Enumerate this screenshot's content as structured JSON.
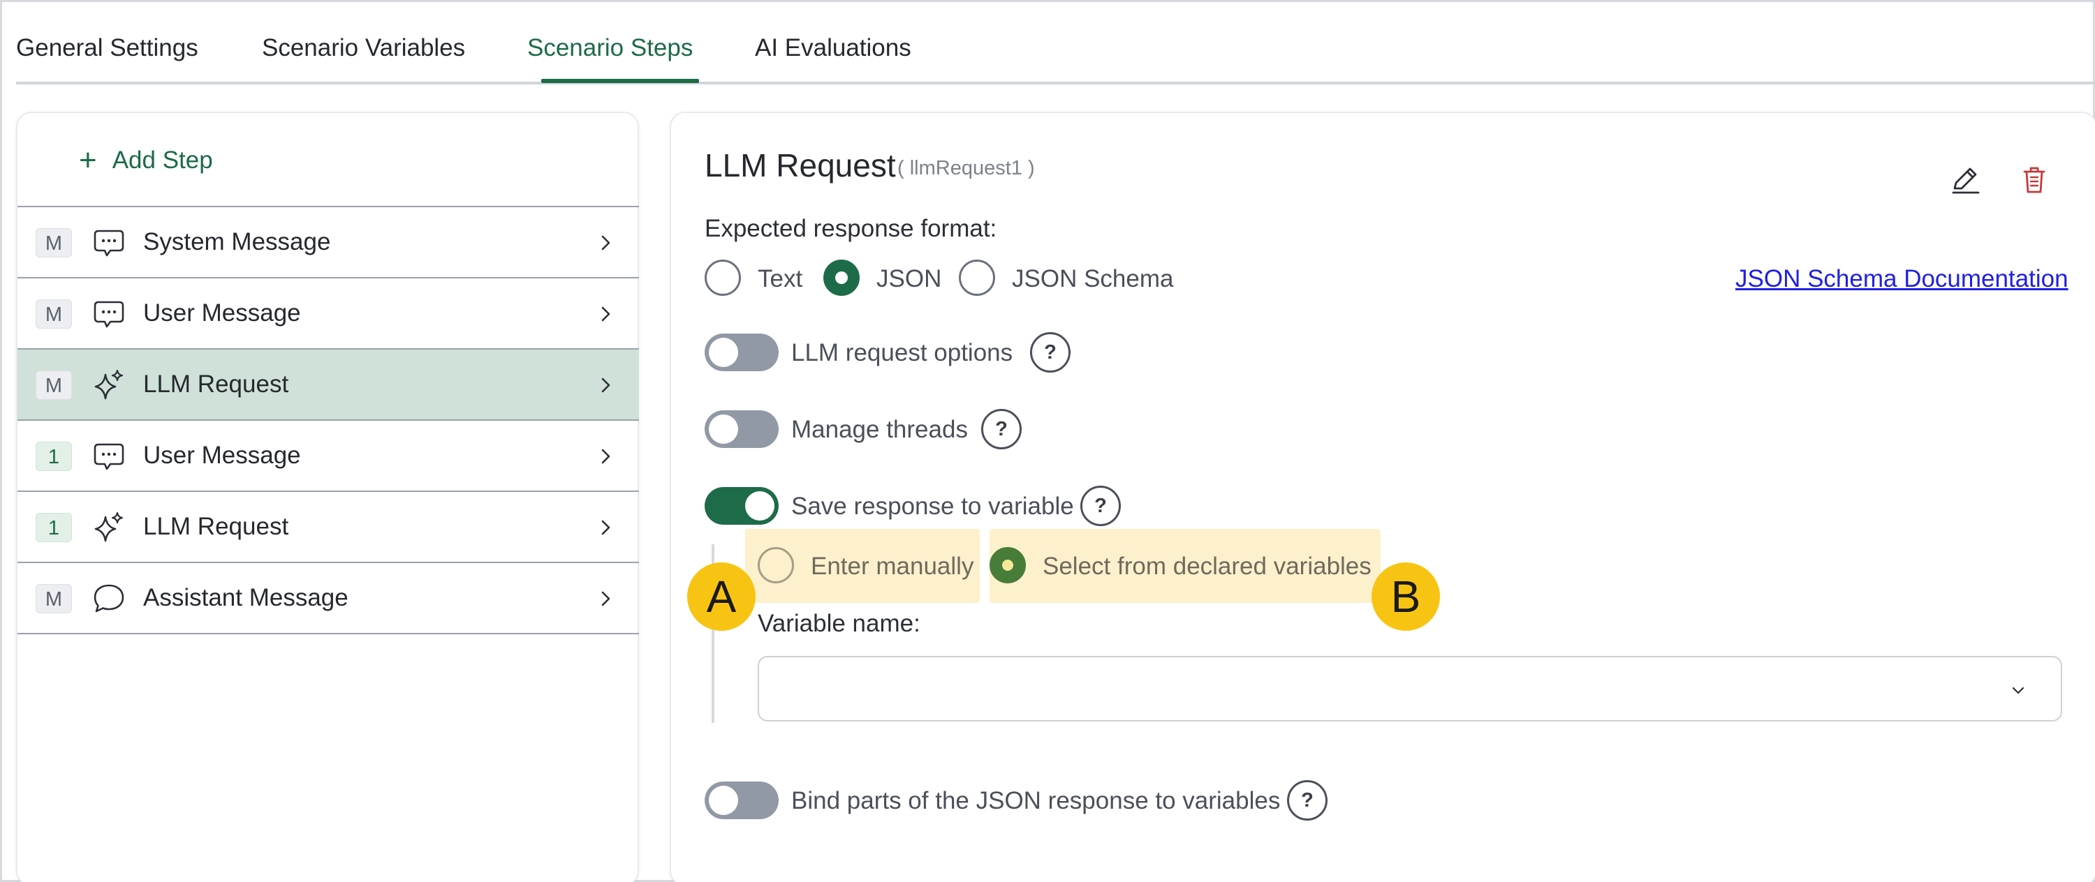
{
  "tabs": [
    {
      "label": "General Settings"
    },
    {
      "label": "Scenario Variables"
    },
    {
      "label": "Scenario Steps"
    },
    {
      "label": "AI Evaluations"
    }
  ],
  "active_tab": "Scenario Steps",
  "sidebar": {
    "add_step_label": "Add Step",
    "steps": [
      {
        "badge": "M",
        "icon": "chat-bubble-icon",
        "label": "System Message"
      },
      {
        "badge": "M",
        "icon": "chat-bubble-icon",
        "label": "User Message"
      },
      {
        "badge": "M",
        "icon": "sparkle-icon",
        "label": "LLM Request",
        "selected": true
      },
      {
        "badge": "1",
        "icon": "chat-bubble-icon",
        "label": "User Message"
      },
      {
        "badge": "1",
        "icon": "sparkle-icon",
        "label": "LLM Request"
      },
      {
        "badge": "M",
        "icon": "speech-bubble-icon",
        "label": "Assistant Message"
      }
    ]
  },
  "detail": {
    "title": "LLM Request",
    "subtitle": "( llmRequest1 )",
    "format_label": "Expected response format:",
    "format_options": [
      {
        "label": "Text",
        "checked": false
      },
      {
        "label": "JSON",
        "checked": true
      },
      {
        "label": "JSON Schema",
        "checked": false
      }
    ],
    "doc_link": "JSON Schema Documentation",
    "toggles": {
      "llm_options": {
        "label": "LLM request options",
        "on": false,
        "help": "?"
      },
      "threads": {
        "label": "Manage threads",
        "on": false,
        "help": "?"
      },
      "save_response": {
        "label": "Save response to variable",
        "on": true,
        "help": "?"
      },
      "bind_parts": {
        "label": "Bind parts of the JSON response to variables",
        "on": false,
        "help": "?"
      }
    },
    "variable_source": [
      {
        "label": "Enter manually",
        "checked": false
      },
      {
        "label": "Select from declared variables",
        "checked": true
      }
    ],
    "variable_name_label": "Variable name:",
    "variable_name_value": ""
  },
  "callouts": {
    "a": "A",
    "b": "B"
  },
  "colors": {
    "accent": "#1d6b48",
    "selected_row": "#cfe1d8",
    "highlight": "#fdf0cc",
    "callout": "#f8c414",
    "delete": "#c43a3a"
  }
}
